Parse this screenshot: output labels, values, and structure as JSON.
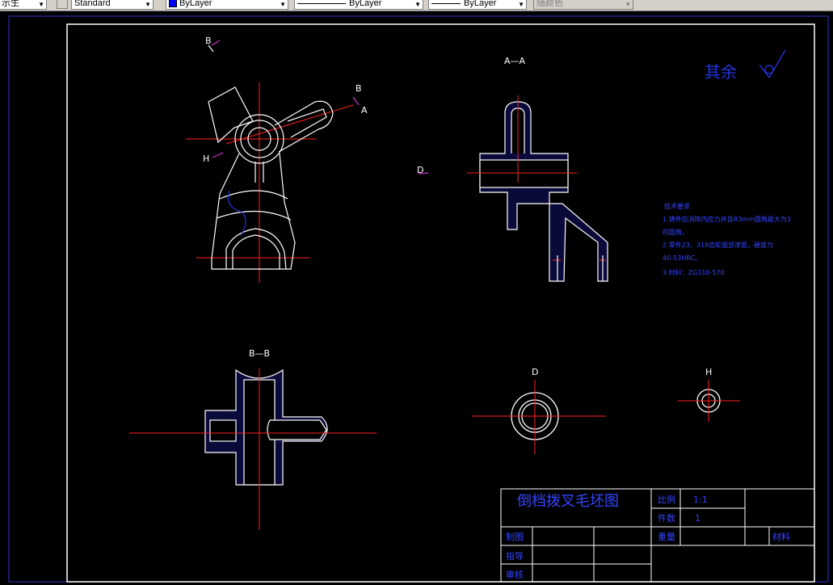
{
  "toolbar": {
    "layer_fragment": "示生",
    "text_style": "Standard",
    "color": "ByLayer",
    "linetype": "ByLayer",
    "lineweight": "ByLayer",
    "plotstyle": "随颜色",
    "color_value": "#0000ff"
  },
  "drawing": {
    "roughness_label": "其余",
    "section_aa": "A—A",
    "section_bb": "B—B",
    "view_d": "D",
    "view_h": "H",
    "mark_b": "B",
    "mark_a": "A",
    "mark_h": "H",
    "mark_d": "D",
    "notes": {
      "heading": "技术要求",
      "line1": "1.铸件应消除内应力并且R3mm圆角最大为3",
      "line2": "的圆角。",
      "line3": "2.零件23、319齿轮面部渗氮，硬度为",
      "line4": "40-53HRC。",
      "line5": "3.材料：ZG310-570"
    },
    "title_block": {
      "title": "倒档拨叉毛坯图",
      "scale_label": "比例",
      "scale_value": "1:1",
      "qty_label": "件数",
      "qty_value": "1",
      "weight_label": "重量",
      "material_label": "材料",
      "drawn_label": "制图",
      "guide_label": "指导",
      "review_label": "审核"
    }
  }
}
